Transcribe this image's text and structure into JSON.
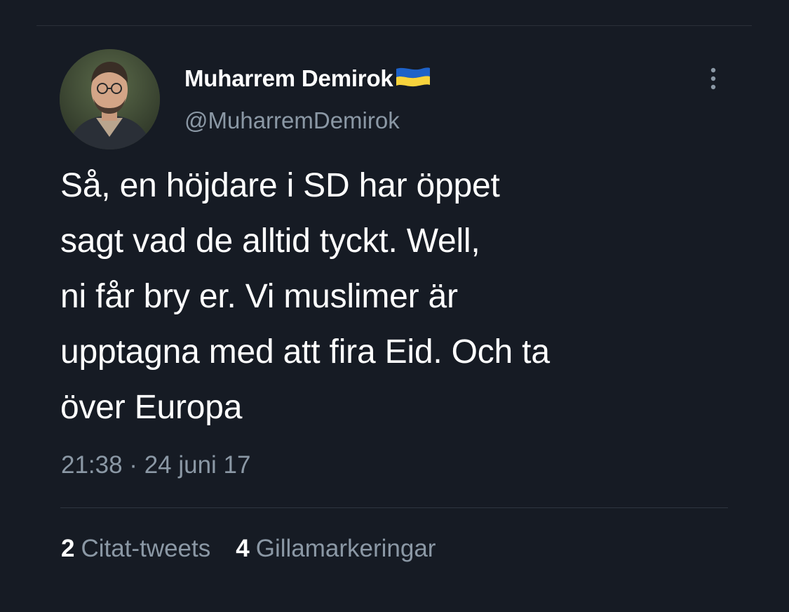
{
  "tweet": {
    "author": {
      "display_name": "Muharrem Demirok",
      "handle": "@MuharremDemirok",
      "badge_icon": "ukraine-flag-icon"
    },
    "text_lines": [
      "Så, en höjdare i SD har öppet",
      "sagt vad de alltid tyckt. Well,",
      "ni får bry er. Vi muslimer är",
      "upptagna med att fira Eid. Och ta",
      "över Europa"
    ],
    "timestamp": "21:38 · 24 juni 17",
    "stats": {
      "quote_count": "2",
      "quote_label": "Citat-tweets",
      "like_count": "4",
      "like_label": "Gillamarkeringar"
    }
  },
  "colors": {
    "background": "#161b24",
    "text_primary": "#ffffff",
    "text_secondary": "#8b98a5",
    "divider": "#2f3540",
    "flag_blue": "#1e62c9",
    "flag_yellow": "#f7d33c"
  }
}
